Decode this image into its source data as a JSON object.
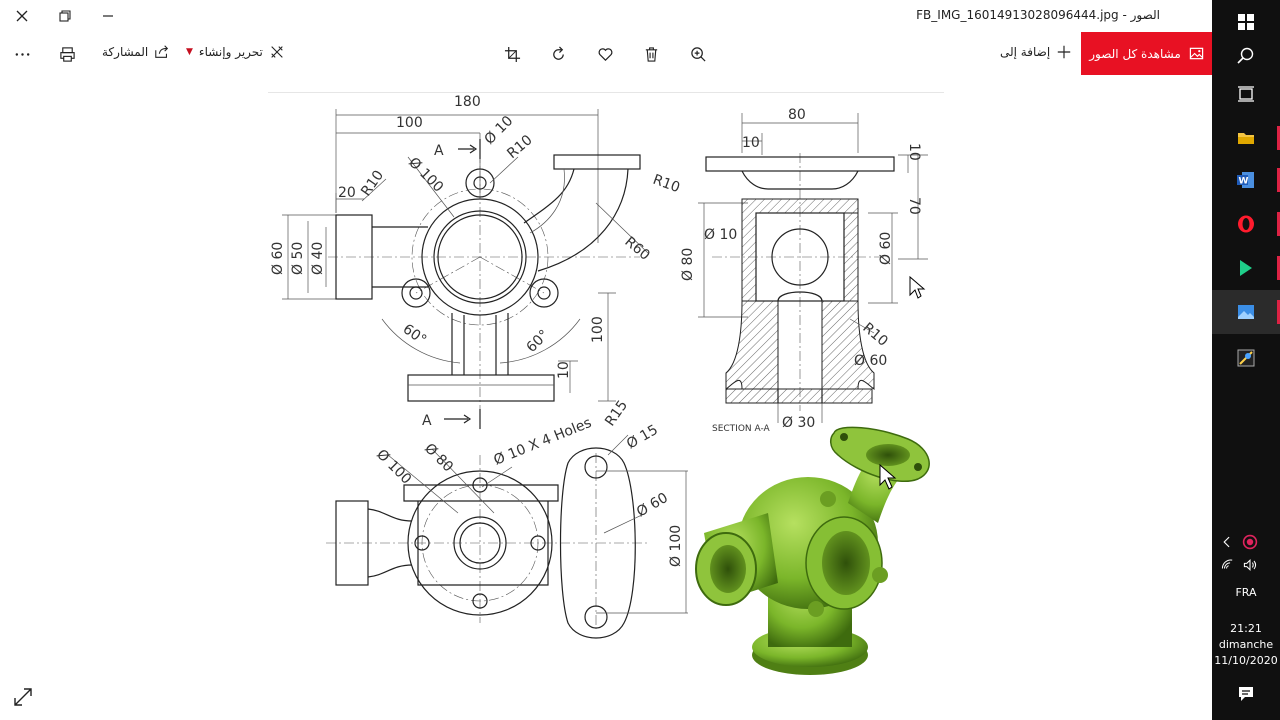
{
  "window": {
    "title": "الصور - FB_IMG_16014913028096444.jpg"
  },
  "toolbar": {
    "share_label": "المشاركة",
    "edit_create_label": "تحرير وإنشاء",
    "add_to_label": "إضافة إلى",
    "see_all_photos_label": "مشاهدة كل الصور",
    "accent_color": "#e81123"
  },
  "drawing": {
    "top_view": {
      "dims": [
        "180",
        "100",
        "Ø 10",
        "R10",
        "A",
        "Ø 100",
        "R10",
        "20",
        "R10",
        "Ø 60",
        "Ø 50",
        "Ø 40",
        "R60",
        "100",
        "60°",
        "60°",
        "10",
        "A"
      ]
    },
    "section_view": {
      "dims": [
        "80",
        "10",
        "10",
        "70",
        "Ø 10",
        "Ø 80",
        "Ø 60",
        "R10",
        "Ø 60",
        "Ø 30"
      ],
      "caption": "SECTION A-A"
    },
    "bottom_view": {
      "dims": [
        "Ø 100",
        "Ø 80",
        "Ø 10 X 4 Holes",
        "R15",
        "Ø 15",
        "Ø 60",
        "Ø 100"
      ]
    },
    "model_color": "#7bb62a"
  },
  "taskbar": {
    "language": "FRA",
    "time": "21:21",
    "day": "dimanche",
    "date": "11/10/2020"
  }
}
